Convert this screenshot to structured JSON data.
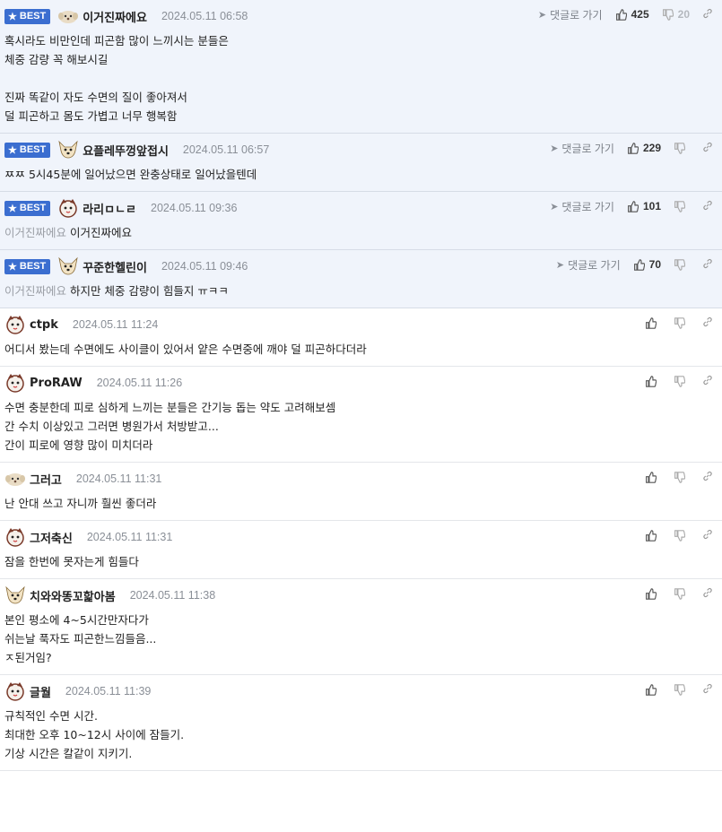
{
  "labels": {
    "best": "BEST",
    "reply": "댓글로 가기"
  },
  "colors": {
    "badge": "#3b6ed0",
    "best_bg": "#f0f4fb",
    "date": "#8a8f97"
  },
  "comments": [
    {
      "best": true,
      "avatar": "pup",
      "nick": "이거진짜에요",
      "date": "2024.05.11 06:58",
      "up": "425",
      "down": "20",
      "quote": "",
      "text": "혹시라도 비만인데 피곤함 많이 느끼시는 분들은\n체중 감량 꼭 해보시길\n\n진짜 똑같이 자도 수면의 질이 좋아져서\n덜 피곤하고 몸도 가볍고 너무 행복함"
    },
    {
      "best": true,
      "avatar": "dog",
      "nick": "요플레뚜껑앞접시",
      "date": "2024.05.11 06:57",
      "up": "229",
      "down": "",
      "quote": "",
      "text": "ㅉㅉ 5시45분에 일어났으면 완충상태로 일어났을텐데"
    },
    {
      "best": true,
      "avatar": "cat",
      "nick": "라리ㅁㄴㄹ",
      "date": "2024.05.11 09:36",
      "up": "101",
      "down": "",
      "quote": "이거진짜에요",
      "text": "이거진짜에요"
    },
    {
      "best": true,
      "avatar": "dog",
      "nick": "꾸준한헬린이",
      "date": "2024.05.11 09:46",
      "up": "70",
      "down": "",
      "quote": "이거진짜에요",
      "text": "하지만 체중 감량이 힘들지 ㅠㅋㅋ"
    },
    {
      "best": false,
      "avatar": "cat",
      "nick": "ctpk",
      "date": "2024.05.11 11:24",
      "up": "",
      "down": "",
      "quote": "",
      "text": "어디서 봤는데 수면에도 사이클이 있어서 얕은 수면중에 깨야 덜 피곤하다더라"
    },
    {
      "best": false,
      "avatar": "cat",
      "nick": "ProRAW",
      "date": "2024.05.11 11:26",
      "up": "",
      "down": "",
      "quote": "",
      "text": "수면 충분한데 피로 심하게 느끼는 분들은 간기능 돕는 약도 고려해보셈\n간 수치 이상있고 그러면 병원가서 처방받고...\n간이 피로에 영향 많이 미치더라"
    },
    {
      "best": false,
      "avatar": "pup",
      "nick": "그러고",
      "date": "2024.05.11 11:31",
      "up": "",
      "down": "",
      "quote": "",
      "text": "난 안대 쓰고 자니까 훨씬 좋더라"
    },
    {
      "best": false,
      "avatar": "cat",
      "nick": "그저축신",
      "date": "2024.05.11 11:31",
      "up": "",
      "down": "",
      "quote": "",
      "text": "잠을 한번에 못자는게 힘들다"
    },
    {
      "best": false,
      "avatar": "dog",
      "nick": "치와와똥꼬핥아봄",
      "date": "2024.05.11 11:38",
      "up": "",
      "down": "",
      "quote": "",
      "text": "본인 평소에 4~5시간만자다가\n쉬는날 푹자도 피곤한느낌들음...\nㅈ된거임?"
    },
    {
      "best": false,
      "avatar": "cat",
      "nick": "글월",
      "date": "2024.05.11 11:39",
      "up": "",
      "down": "",
      "quote": "",
      "text": "규칙적인 수면 시간.\n최대한 오후 10~12시 사이에 잠들기.\n기상 시간은 칼같이 지키기."
    }
  ]
}
